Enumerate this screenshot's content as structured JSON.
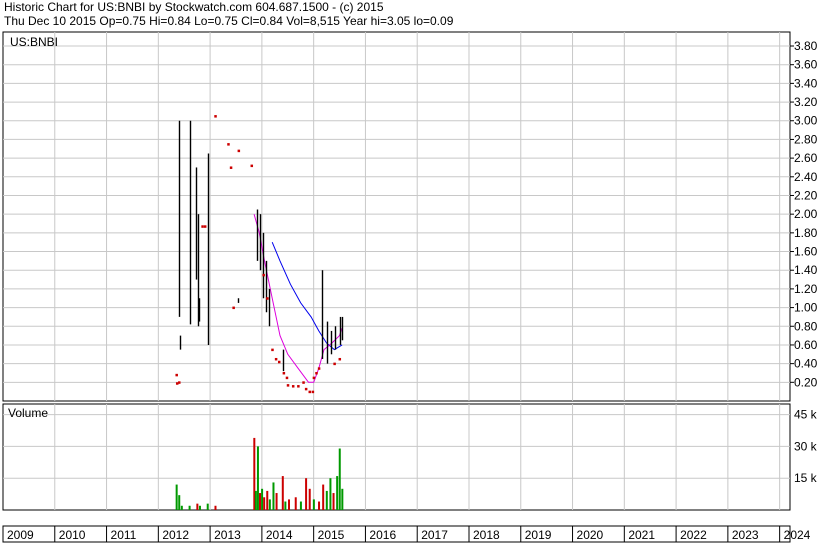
{
  "header": {
    "line1": "Historic Chart for US:BNBI by Stockwatch.com 604.687.1500 - (c) 2015",
    "line2": "Thu Dec 10 2015  Op=0.75  Hi=0.84  Lo=0.75  Cl=0.84  Vol=8,515  Year hi=3.05  lo=0.09"
  },
  "chart_data": {
    "type": "line",
    "symbol": "US:BNBI",
    "volume_label": "Volume",
    "price_axis": {
      "ticks": [
        0.2,
        0.4,
        0.6,
        0.8,
        1.0,
        1.2,
        1.4,
        1.6,
        1.8,
        2.0,
        2.2,
        2.4,
        2.6,
        2.8,
        3.0,
        3.2,
        3.4,
        3.6,
        3.8
      ],
      "tick_labels": [
        "0.20",
        "0.40",
        "0.60",
        "0.80",
        "1.00",
        "1.20",
        "1.40",
        "1.60",
        "1.80",
        "2.00",
        "2.20",
        "2.40",
        "2.60",
        "2.80",
        "3.00",
        "3.20",
        "3.40",
        "3.60",
        "3.80"
      ],
      "range": [
        0.0,
        3.95
      ]
    },
    "volume_axis": {
      "ticks": [
        15000,
        30000,
        45000
      ],
      "tick_labels": [
        "15 k",
        "30 k",
        "45 k"
      ],
      "range": [
        0,
        50000
      ]
    },
    "x_axis": {
      "years": [
        "2009",
        "2010",
        "2011",
        "2012",
        "2013",
        "2014",
        "2015",
        "2016",
        "2017",
        "2018",
        "2019",
        "2020",
        "2021",
        "2022",
        "2023",
        "2024"
      ],
      "range": [
        2009.0,
        2024.2
      ]
    },
    "price_bars": [
      {
        "t": 2012.4,
        "hi": 3.0,
        "lo": 0.9
      },
      {
        "t": 2012.42,
        "hi": 0.7,
        "lo": 0.55
      },
      {
        "t": 2012.62,
        "hi": 3.0,
        "lo": 0.82
      },
      {
        "t": 2012.72,
        "hi": 2.5,
        "lo": 1.3
      },
      {
        "t": 2012.77,
        "hi": 2.0,
        "lo": 0.8
      },
      {
        "t": 2012.78,
        "hi": 1.1,
        "lo": 0.85
      },
      {
        "t": 2012.95,
        "hi": 2.65,
        "lo": 0.6
      },
      {
        "t": 2013.54,
        "hi": 1.1,
        "lo": 1.05
      },
      {
        "t": 2013.9,
        "hi": 2.05,
        "lo": 1.5
      },
      {
        "t": 2013.96,
        "hi": 2.0,
        "lo": 1.4
      },
      {
        "t": 2014.02,
        "hi": 1.8,
        "lo": 1.1
      },
      {
        "t": 2014.08,
        "hi": 1.5,
        "lo": 0.95
      },
      {
        "t": 2014.13,
        "hi": 1.2,
        "lo": 0.8
      },
      {
        "t": 2014.4,
        "hi": 0.55,
        "lo": 0.32
      },
      {
        "t": 2015.17,
        "hi": 1.4,
        "lo": 0.45
      },
      {
        "t": 2015.25,
        "hi": 0.85,
        "lo": 0.4
      },
      {
        "t": 2015.33,
        "hi": 0.75,
        "lo": 0.5
      },
      {
        "t": 2015.42,
        "hi": 0.8,
        "lo": 0.55
      },
      {
        "t": 2015.5,
        "hi": 0.9,
        "lo": 0.6
      },
      {
        "t": 2015.55,
        "hi": 0.9,
        "lo": 0.65
      }
    ],
    "close_points": [
      {
        "t": 2012.35,
        "v": 0.28
      },
      {
        "t": 2012.36,
        "v": 0.19
      },
      {
        "t": 2012.4,
        "v": 0.2
      },
      {
        "t": 2012.85,
        "v": 1.87
      },
      {
        "t": 2012.9,
        "v": 1.87
      },
      {
        "t": 2013.1,
        "v": 3.05
      },
      {
        "t": 2013.35,
        "v": 2.75
      },
      {
        "t": 2013.4,
        "v": 2.5
      },
      {
        "t": 2013.55,
        "v": 2.68
      },
      {
        "t": 2013.8,
        "v": 2.52
      },
      {
        "t": 2013.45,
        "v": 1.0
      },
      {
        "t": 2014.03,
        "v": 1.35
      },
      {
        "t": 2014.1,
        "v": 1.1
      },
      {
        "t": 2014.2,
        "v": 0.55
      },
      {
        "t": 2014.27,
        "v": 0.45
      },
      {
        "t": 2014.33,
        "v": 0.42
      },
      {
        "t": 2014.42,
        "v": 0.3
      },
      {
        "t": 2014.48,
        "v": 0.25
      },
      {
        "t": 2014.5,
        "v": 0.17
      },
      {
        "t": 2014.6,
        "v": 0.16
      },
      {
        "t": 2014.7,
        "v": 0.16
      },
      {
        "t": 2014.8,
        "v": 0.2
      },
      {
        "t": 2014.85,
        "v": 0.13
      },
      {
        "t": 2014.92,
        "v": 0.1
      },
      {
        "t": 2014.98,
        "v": 0.1
      },
      {
        "t": 2015.0,
        "v": 0.25
      },
      {
        "t": 2015.05,
        "v": 0.3
      },
      {
        "t": 2015.1,
        "v": 0.35
      },
      {
        "t": 2015.4,
        "v": 0.4
      },
      {
        "t": 2015.5,
        "v": 0.45
      }
    ],
    "series": [
      {
        "color": "#0000ee",
        "points": [
          [
            2014.2,
            1.7
          ],
          [
            2014.35,
            1.5
          ],
          [
            2014.55,
            1.25
          ],
          [
            2014.75,
            1.05
          ],
          [
            2014.95,
            0.9
          ],
          [
            2015.1,
            0.75
          ],
          [
            2015.25,
            0.62
          ],
          [
            2015.4,
            0.55
          ],
          [
            2015.55,
            0.6
          ]
        ]
      },
      {
        "color": "#dd00dd",
        "points": [
          [
            2013.85,
            2.0
          ],
          [
            2013.95,
            1.8
          ],
          [
            2014.05,
            1.5
          ],
          [
            2014.2,
            1.1
          ],
          [
            2014.35,
            0.7
          ],
          [
            2014.5,
            0.5
          ],
          [
            2014.7,
            0.35
          ],
          [
            2014.9,
            0.2
          ],
          [
            2015.0,
            0.2
          ],
          [
            2015.1,
            0.35
          ],
          [
            2015.2,
            0.55
          ],
          [
            2015.35,
            0.62
          ],
          [
            2015.5,
            0.7
          ],
          [
            2015.55,
            0.78
          ]
        ]
      }
    ],
    "volume_bars": [
      {
        "t": 2012.35,
        "v": 12000,
        "c": "#009900"
      },
      {
        "t": 2012.4,
        "v": 7000,
        "c": "#009900"
      },
      {
        "t": 2012.45,
        "v": 2000,
        "c": "#009900"
      },
      {
        "t": 2012.6,
        "v": 2000,
        "c": "#009900"
      },
      {
        "t": 2012.75,
        "v": 3000,
        "c": "#cc0000"
      },
      {
        "t": 2012.8,
        "v": 2000,
        "c": "#009900"
      },
      {
        "t": 2012.95,
        "v": 3000,
        "c": "#009900"
      },
      {
        "t": 2013.1,
        "v": 2000,
        "c": "#cc0000"
      },
      {
        "t": 2013.85,
        "v": 34000,
        "c": "#cc0000"
      },
      {
        "t": 2013.88,
        "v": 9000,
        "c": "#009900"
      },
      {
        "t": 2013.92,
        "v": 30000,
        "c": "#009900"
      },
      {
        "t": 2013.96,
        "v": 8000,
        "c": "#cc0000"
      },
      {
        "t": 2014.0,
        "v": 10000,
        "c": "#009900"
      },
      {
        "t": 2014.04,
        "v": 6000,
        "c": "#cc0000"
      },
      {
        "t": 2014.1,
        "v": 9000,
        "c": "#cc0000"
      },
      {
        "t": 2014.15,
        "v": 5000,
        "c": "#009900"
      },
      {
        "t": 2014.22,
        "v": 13000,
        "c": "#009900"
      },
      {
        "t": 2014.28,
        "v": 8000,
        "c": "#cc0000"
      },
      {
        "t": 2014.4,
        "v": 16000,
        "c": "#cc0000"
      },
      {
        "t": 2014.45,
        "v": 4000,
        "c": "#009900"
      },
      {
        "t": 2014.52,
        "v": 5000,
        "c": "#cc0000"
      },
      {
        "t": 2014.65,
        "v": 6000,
        "c": "#cc0000"
      },
      {
        "t": 2014.75,
        "v": 4000,
        "c": "#009900"
      },
      {
        "t": 2014.85,
        "v": 15000,
        "c": "#cc0000"
      },
      {
        "t": 2014.92,
        "v": 10000,
        "c": "#cc0000"
      },
      {
        "t": 2015.0,
        "v": 5000,
        "c": "#009900"
      },
      {
        "t": 2015.1,
        "v": 4000,
        "c": "#cc0000"
      },
      {
        "t": 2015.18,
        "v": 12000,
        "c": "#cc0000"
      },
      {
        "t": 2015.25,
        "v": 9000,
        "c": "#009900"
      },
      {
        "t": 2015.32,
        "v": 15000,
        "c": "#009900"
      },
      {
        "t": 2015.38,
        "v": 8000,
        "c": "#cc0000"
      },
      {
        "t": 2015.45,
        "v": 16000,
        "c": "#009900"
      },
      {
        "t": 2015.5,
        "v": 29000,
        "c": "#009900"
      },
      {
        "t": 2015.55,
        "v": 10000,
        "c": "#009900"
      }
    ]
  }
}
